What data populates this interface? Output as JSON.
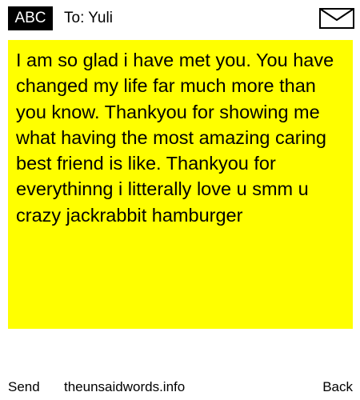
{
  "header": {
    "mode_badge": "ABC",
    "recipient": "To: Yuli",
    "mail_icon": "envelope-icon"
  },
  "message": {
    "text": "I am so glad i have met you. You have changed my life far much more than you know. Thankyou for showing me what having the most amazing caring best friend is like. Thankyou for everythinng i litterally love u smm u crazy jackrabbit hamburger",
    "background": "#ffff00"
  },
  "footer": {
    "send_label": "Send",
    "site_label": "theunsaidwords.info",
    "back_label": "Back"
  }
}
